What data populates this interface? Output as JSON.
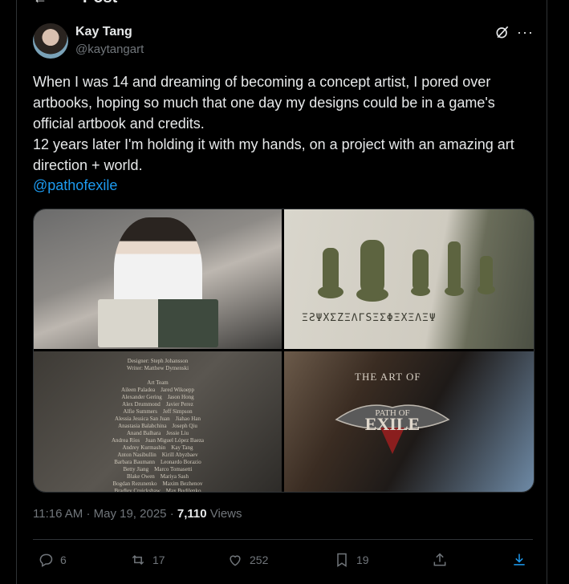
{
  "header": {
    "title": "Post"
  },
  "author": {
    "name": "Kay Tang",
    "handle": "@kaytangart"
  },
  "tweet": {
    "text": "When I was 14 and dreaming of becoming a concept artist, I pored over artbooks, hoping so much that one day my designs could be in a game's official artbook and credits.\n12 years later I'm holding it with my hands, on a project with an amazing art direction + world.",
    "mention": "@pathofexile"
  },
  "media": {
    "credits_text": "Designer: Steph Johansson\nWriter: Matthew Dymenski\n\nArt Team\nAileen Paladea    Jared Wikoepp\nAlexander Gering    Jason Hong\nAlex Drummond    Javier Perez\nAlfie Summers    Jeff Simpson\nAlessia Jessica San Juan    Jiahao Han\nAnastasia Balabchina    Joseph Qiu\nAnand Balhara    Jessie Liu\nAndrea Ríos    Juan Miguel López Baeza\nAndrey Kurmashin    Kay Tang\nAnton Nasibullin    Kirill Abyzbaev\nBarbara Baumann    Leonardo Borazio\nBetty Jiang    Marco Tomasetti\nBlake Owen    Mariya Sash\nBogdan Rezunenko    Maxim Bezhenov\nBradley Cruickshaw    Max Budilenko\nBruce Daye    Maxim Verehin\nChris Paladin    Michael Biemerhanasent\nDana Ottomanelli    Mike Franchina\nDaniel Thiger    Nicholas De Spain\nDavid Paryman\nDarius Kim",
    "book_art_of": "THE ART OF",
    "book_logo_top": "PATH OF",
    "book_logo_main": "EXILE",
    "rune_text": "ΞƧΨXΣZΞΛΓSΞΣΦΞXΞΛΞΨ"
  },
  "meta": {
    "time": "11:16 AM",
    "date": "May 19, 2025",
    "views": "7,110",
    "views_label": "Views"
  },
  "actions": {
    "replies": "6",
    "reposts": "17",
    "likes": "252",
    "bookmarks": "19"
  },
  "colors": {
    "background": "#000000",
    "text": "#e7e9ea",
    "secondary": "#71767b",
    "accent": "#1d9bf0",
    "border": "#2f3336"
  }
}
